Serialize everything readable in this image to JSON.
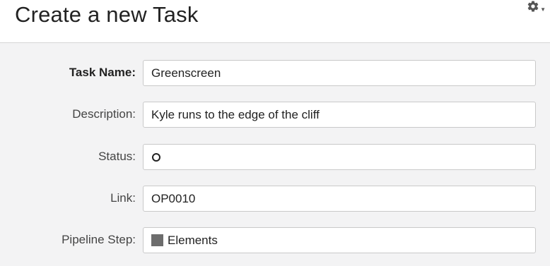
{
  "header": {
    "title": "Create a new Task",
    "settings_icon": "gear-icon"
  },
  "form": {
    "task_name": {
      "label": "Task Name:",
      "value": "Greenscreen"
    },
    "description": {
      "label": "Description:",
      "value": "Kyle runs to the edge of the cliff"
    },
    "status": {
      "label": "Status:",
      "icon": "status-circle-icon"
    },
    "link": {
      "label": "Link:",
      "value": "OP0010"
    },
    "pipeline_step": {
      "label": "Pipeline Step:",
      "value": "Elements",
      "swatch_color": "#6d6d6d"
    }
  }
}
